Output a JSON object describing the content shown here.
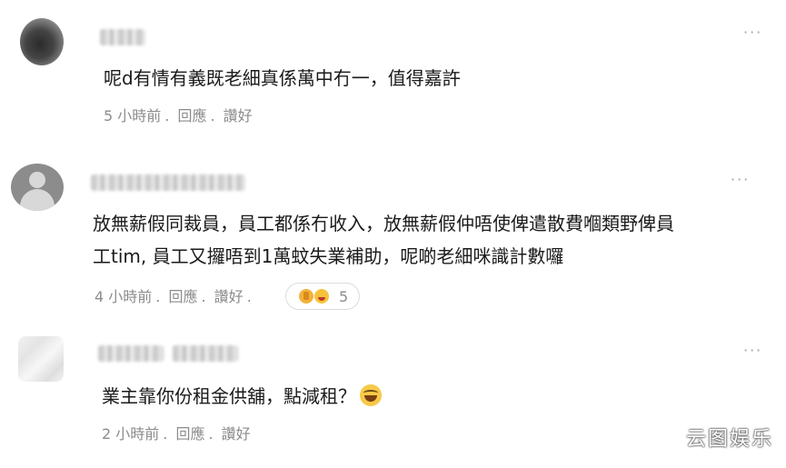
{
  "comments": [
    {
      "text": "呢d有情有義既老細真係萬中冇一，值得嘉許",
      "time": "5 小時前",
      "reply_label": "回應",
      "like_label": "讚好",
      "separator": ".",
      "more_icon": "more-dots-icon"
    },
    {
      "text_line1": "放無薪假同裁員，員工都係冇收入，放無薪假仲唔使俾遣散費嗰類野俾員",
      "text_line2": "工tim, 員工又攞唔到1萬蚊失業補助，呢啲老細咪識計數囉",
      "time": "4 小時前",
      "reply_label": "回應",
      "like_label": "讚好",
      "separator": ".",
      "reaction_count": "5",
      "reaction_icons": [
        "thumbs-up-icon",
        "laugh-icon"
      ],
      "more_icon": "more-dots-icon"
    },
    {
      "text": "業主靠你份租金供舖，點減租？",
      "emoji": "grinning-sweat-emoji",
      "time": "2 小時前",
      "reply_label": "回應",
      "like_label": "讚好",
      "separator": ".",
      "more_icon": "more-dots-icon"
    }
  ],
  "watermark": "云图娱乐",
  "more_glyph": "···"
}
